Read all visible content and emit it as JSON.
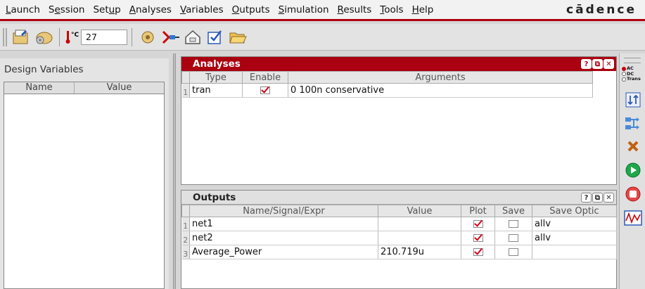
{
  "menu": {
    "items": [
      {
        "pre": "",
        "u": "L",
        "post": "aunch"
      },
      {
        "pre": "S",
        "u": "e",
        "post": "ssion"
      },
      {
        "pre": "Set",
        "u": "u",
        "post": "p"
      },
      {
        "pre": "",
        "u": "A",
        "post": "nalyses"
      },
      {
        "pre": "",
        "u": "V",
        "post": "ariables"
      },
      {
        "pre": "",
        "u": "O",
        "post": "utputs"
      },
      {
        "pre": "",
        "u": "S",
        "post": "imulation"
      },
      {
        "pre": "",
        "u": "R",
        "post": "esults"
      },
      {
        "pre": "",
        "u": "T",
        "post": "ools"
      },
      {
        "pre": "",
        "u": "H",
        "post": "elp"
      }
    ],
    "brand": "cādence"
  },
  "toolbar": {
    "temperature": "27",
    "temp_label": "°C"
  },
  "design_variables": {
    "title": "Design Variables",
    "columns": [
      "Name",
      "Value"
    ]
  },
  "analyses": {
    "title": "Analyses",
    "columns": [
      "Type",
      "Enable",
      "Arguments"
    ],
    "rows": [
      {
        "num": "1",
        "type": "tran",
        "enabled": true,
        "arguments": "0 100n conservative"
      }
    ]
  },
  "outputs": {
    "title": "Outputs",
    "columns": [
      "Name/Signal/Expr",
      "Value",
      "Plot",
      "Save",
      "Save Optic"
    ],
    "rows": [
      {
        "num": "1",
        "name": "net1",
        "value": "",
        "plot": true,
        "save": false,
        "save_options": "allv"
      },
      {
        "num": "2",
        "name": "net2",
        "value": "",
        "plot": true,
        "save": false,
        "save_options": "allv"
      },
      {
        "num": "3",
        "name": "Average_Power",
        "value": "210.719u",
        "plot": true,
        "save": false,
        "save_options": ""
      }
    ]
  },
  "panel_buttons": {
    "help": "?",
    "restore": "⧉",
    "close": "✕"
  },
  "right_bar": {
    "analysis_radios": [
      {
        "label": "AC",
        "selected": true
      },
      {
        "label": "DC",
        "selected": false
      },
      {
        "label": "Trans",
        "selected": false
      }
    ]
  },
  "colors": {
    "accent": "#aa0010",
    "check": "#d2001a"
  }
}
